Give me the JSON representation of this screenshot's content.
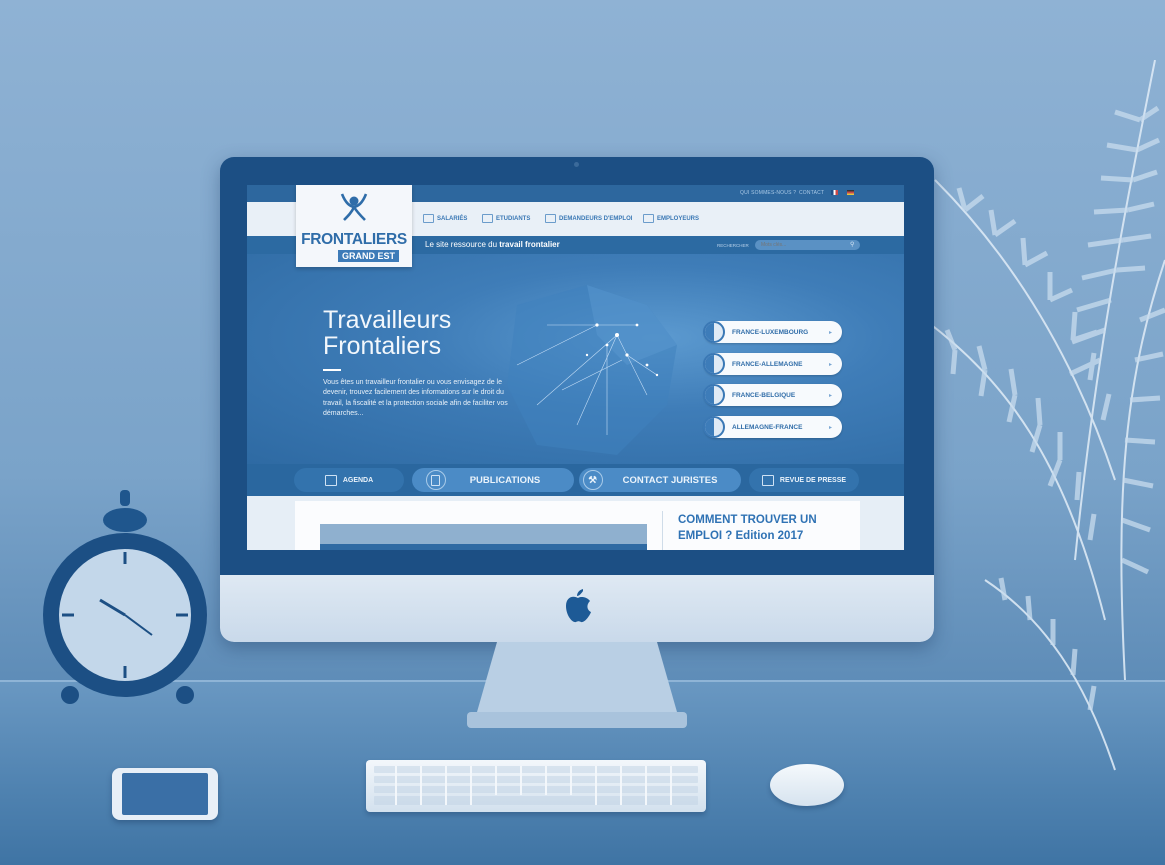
{
  "site": {
    "topbar": {
      "about_link": "QUI SOMMES-NOUS ?",
      "contact_link": "CONTACT"
    },
    "nav": {
      "items": [
        {
          "label": "SALARIÉS",
          "icon": "briefcase-icon"
        },
        {
          "label": "ETUDIANTS",
          "icon": "graduation-cap-icon"
        },
        {
          "label": "DEMANDEURS D'EMPLOI",
          "icon": "id-card-icon"
        },
        {
          "label": "EMPLOYEURS",
          "icon": "people-icon"
        }
      ]
    },
    "logo": {
      "main": "FRONTALIERS",
      "sub": "GRAND EST"
    },
    "tagline": {
      "prefix": "Le site ressource du ",
      "emphasis": "travail frontalier"
    },
    "search": {
      "label": "RECHERCHER",
      "placeholder": "Mots clés..."
    },
    "hero": {
      "title_line1": "Travailleurs",
      "title_line2": "Frontaliers",
      "text": "Vous êtes un travailleur frontalier ou vous envisagez de le devenir, trouvez facilement des informations sur le droit du travail, la fiscalité et la protection sociale afin de faciliter vos démarches..."
    },
    "regions": [
      {
        "label": "FRANCE-LUXEMBOURG"
      },
      {
        "label": "FRANCE-ALLEMAGNE"
      },
      {
        "label": "FRANCE-BELGIQUE"
      },
      {
        "label": "ALLEMAGNE-FRANCE"
      }
    ],
    "quicklinks": {
      "agenda": "AGENDA",
      "publications": "PUBLICATIONS",
      "contact_juristes": "CONTACT JURISTES",
      "revue_de_presse": "REVUE DE PRESSE"
    },
    "article": {
      "title_line1": "COMMENT TROUVER UN",
      "title_line2": "EMPLOI ? Edition 2017"
    }
  }
}
